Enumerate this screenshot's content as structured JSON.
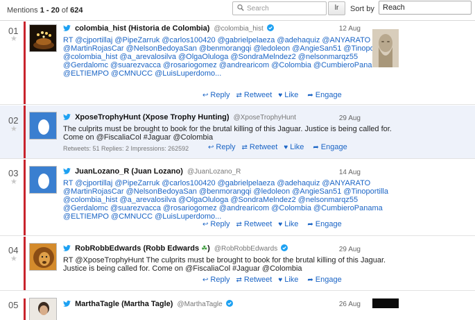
{
  "toolbar": {
    "mentions_prefix": "Mentions",
    "range": "1 - 20",
    "of_text": "of",
    "total": "624",
    "search_placeholder": "Search",
    "go_label": "lr",
    "sort_label": "Sort by",
    "sort_value": "Reach"
  },
  "actions": {
    "reply": "Reply",
    "retweet": "Retweet",
    "like": "Like",
    "engage": "Engage"
  },
  "mentions": [
    {
      "num": "01",
      "name": "colombia_hist (Historia de Colombia)",
      "handle": "@colombia_hist",
      "verified": true,
      "date": "12 Aug",
      "text": "RT @cjportillaj @PipeZarruk @carlos100420 @gabrielpelaeza @adehaquiz @ANYARATO @MartinRojasCar @NelsonBedoyaSan @benmorangqi @ledoleon @AngieSan51 @Tinoportilla @colombia_hist @a_arevalosilva @OlgaOluloga @SondraMelndez2 @nelsonmarqz55 @Gerdalomc @suarezvacca @rosariogomez @andrearicom @Colombia @CumbieroPanama @ELTIEMPO @CMNUCC @LuisLuperdomo..."
    },
    {
      "num": "02",
      "name": "XposeTrophyHunt (Xpose Trophy Hunting)",
      "handle": "@XposeTrophyHunt",
      "verified": false,
      "date": "29 Aug",
      "text": "The culprits must be brought to book for the brutal killing of this Jaguar. Justice is being called for. Come on @FiscaliaCol #Jaguar @Colombia",
      "stats": "Retweets: 51  Replies: 2  Impressions: 262592"
    },
    {
      "num": "03",
      "name": "JuanLozano_R (Juan Lozano)",
      "handle": "@JuanLozano_R",
      "verified": false,
      "date": "14 Aug",
      "text": "RT @cjportillaj @PipeZarruk @carlos100420 @gabrielpelaeza @adehaquiz @ANYARATO @MartinRojasCar @NelsonBedoyaSan @benmorangqi @ledoleon @AngieSan51 @Tinoportilla @colombia_hist @a_arevalosilva @OlgaOluloga @SondraMelndez2 @nelsonmarqz55 @Gerdalomc @suarezvacca @rosariogomez @andrearicom @Colombia @CumbieroPanama @ELTIEMPO @CMNUCC @LuisLuperdomo..."
    },
    {
      "num": "04",
      "name": "RobRobbEdwards (Robb Edwards",
      "name_suffix": ")",
      "handle": "@RobRobbEdwards",
      "verified": true,
      "date": "29 Aug",
      "text": "RT @XposeTrophyHunt The culprits must be brought to book for the brutal killing of this Jaguar. Justice is being called for. Come on @FiscaliaCol #Jaguar @Colombia"
    },
    {
      "num": "05",
      "name": "MarthaTagle (Martha Tagle)",
      "handle": "@MarthaTagle",
      "verified": true,
      "date": "26 Aug"
    }
  ],
  "colors": {
    "accent_red": "#c8232c",
    "link_blue": "#1a64c5",
    "highlight_row": "#eef2fa",
    "twitter_blue": "#1da1f2"
  }
}
